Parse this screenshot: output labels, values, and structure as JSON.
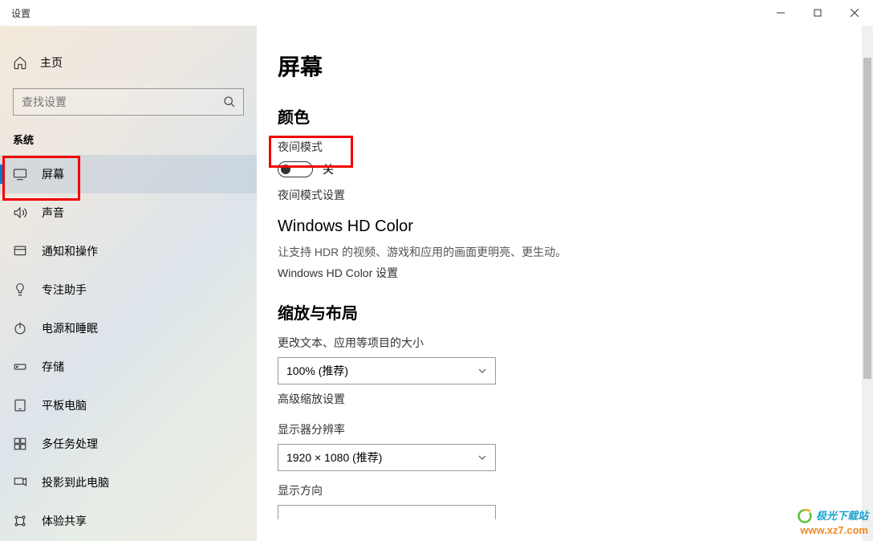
{
  "titlebar": {
    "title": "设置"
  },
  "sidebar": {
    "home_label": "主页",
    "search_placeholder": "查找设置",
    "section_title": "系统",
    "items": [
      {
        "label": "屏幕",
        "active": true
      },
      {
        "label": "声音"
      },
      {
        "label": "通知和操作"
      },
      {
        "label": "专注助手"
      },
      {
        "label": "电源和睡眠"
      },
      {
        "label": "存储"
      },
      {
        "label": "平板电脑"
      },
      {
        "label": "多任务处理"
      },
      {
        "label": "投影到此电脑"
      },
      {
        "label": "体验共享"
      }
    ]
  },
  "main": {
    "page_title": "屏幕",
    "color": {
      "group_title": "颜色",
      "night_mode_label": "夜间模式",
      "night_mode_state": "关",
      "night_mode_settings": "夜间模式设置"
    },
    "hd": {
      "title": "Windows HD Color",
      "desc": "让支持 HDR 的视频、游戏和应用的画面更明亮、更生动。",
      "link": "Windows HD Color 设置"
    },
    "scale": {
      "group_title": "缩放与布局",
      "text_size_label": "更改文本、应用等项目的大小",
      "text_size_value": "100% (推荐)",
      "advanced_link": "高级缩放设置",
      "resolution_label": "显示器分辨率",
      "resolution_value": "1920 × 1080 (推荐)",
      "orientation_label": "显示方向"
    }
  },
  "watermark": {
    "line1": "极光下载站",
    "line2": "www.xz7.com"
  }
}
